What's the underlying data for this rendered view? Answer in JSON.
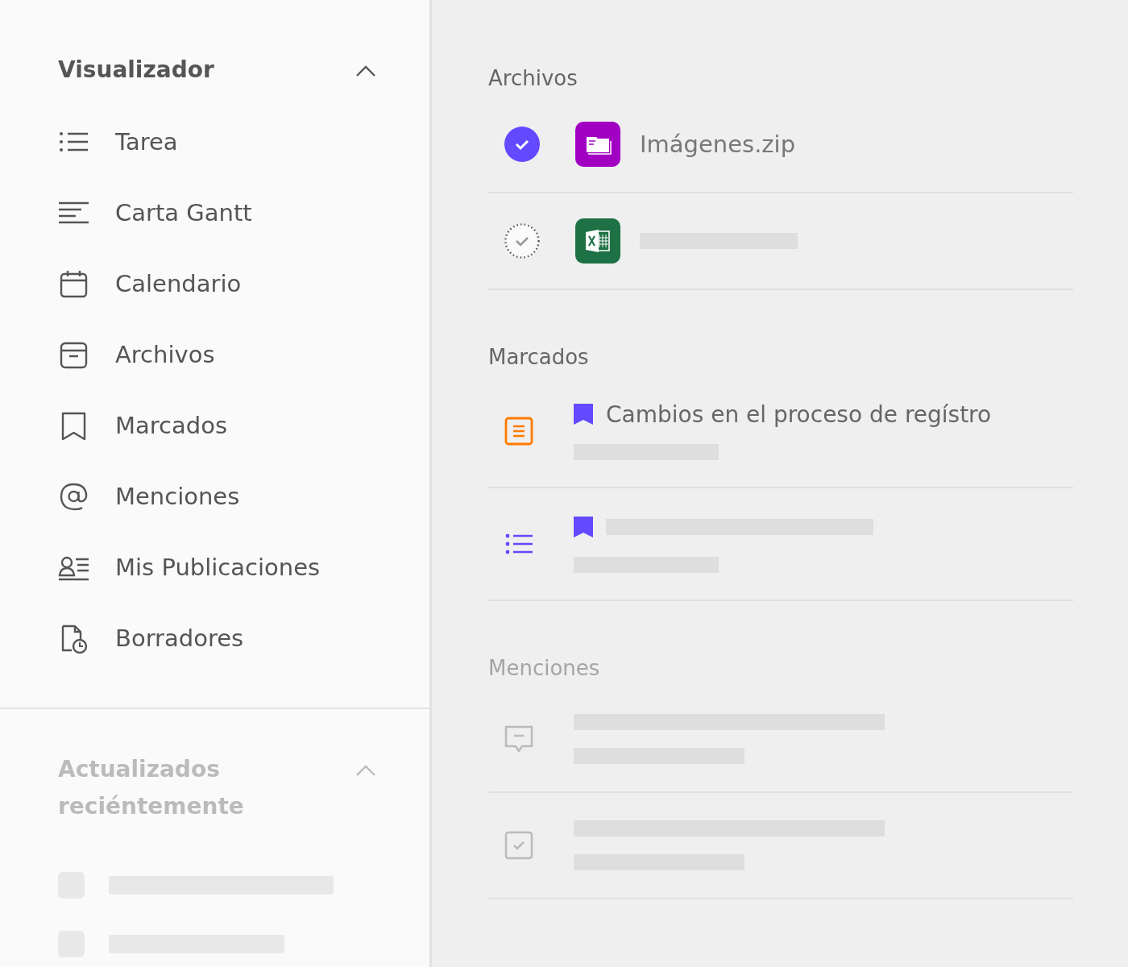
{
  "sidebar": {
    "sections": [
      {
        "title": "Visualizador",
        "expanded": true,
        "muted": false,
        "items": [
          {
            "kind": "list",
            "label": "Tarea"
          },
          {
            "kind": "gantt",
            "label": "Carta Gantt"
          },
          {
            "kind": "calendar",
            "label": "Calendario"
          },
          {
            "kind": "archive",
            "label": "Archivos"
          },
          {
            "kind": "bookmark",
            "label": "Marcados"
          },
          {
            "kind": "mention",
            "label": "Menciones"
          },
          {
            "kind": "posts",
            "label": "Mis Publicaciones"
          },
          {
            "kind": "drafts",
            "label": "Borradores"
          }
        ]
      },
      {
        "title": "Actualizados reciéntemente",
        "expanded": true,
        "muted": true
      }
    ]
  },
  "files": {
    "title": "Archivos",
    "muted": false,
    "rows": [
      {
        "kind": "zip",
        "name": "Imágenes.zip",
        "selected": true
      },
      {
        "kind": "spreadsheet",
        "selected": false
      }
    ]
  },
  "bookmarks": {
    "title": "Marcados",
    "muted": false,
    "rows": [
      {
        "kind": "document",
        "title": "Cambios en el proceso de regístro"
      },
      {
        "kind": "task-list"
      }
    ]
  },
  "mentions": {
    "title": "Menciones",
    "muted": true,
    "rows": [
      {
        "kind": "comment"
      },
      {
        "kind": "task"
      }
    ]
  }
}
